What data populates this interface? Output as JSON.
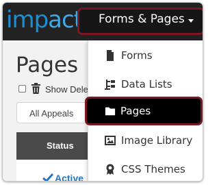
{
  "navbar": {
    "logo_main": "imp",
    "logo_accent": "act",
    "menu_label": "Forms & Pages"
  },
  "page": {
    "title": "Pages",
    "show_deleted_label": "Show Dele",
    "appeals_filter": "All Appeals",
    "table": {
      "status_header": "Status",
      "first_row_status": "Active"
    }
  },
  "dropdown": {
    "items": [
      {
        "label": "Forms",
        "icon": "file-icon"
      },
      {
        "label": "Data Lists",
        "icon": "list-tree-icon"
      },
      {
        "label": "Pages",
        "icon": "folder-icon",
        "highlighted": true
      },
      {
        "label": "Image Library",
        "icon": "image-icon"
      },
      {
        "label": "CSS Themes",
        "icon": "certificate-icon"
      }
    ]
  },
  "colors": {
    "navbar_bg": "#222222",
    "highlight_border": "#7a1722",
    "logo_blue": "#1b8fd6",
    "link_blue": "#1f75c9"
  }
}
